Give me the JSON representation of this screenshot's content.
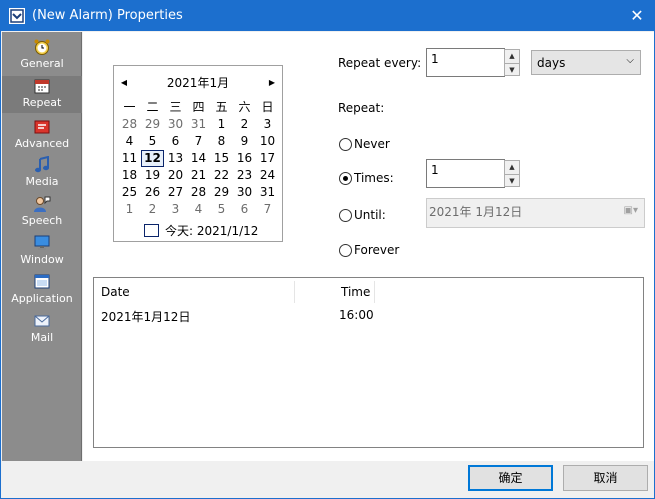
{
  "window": {
    "title": "(New Alarm) Properties",
    "close_glyph": "✕"
  },
  "sidebar": {
    "items": [
      {
        "label": "General",
        "icon": "clock-icon"
      },
      {
        "label": "Repeat",
        "icon": "calendar-icon",
        "active": true
      },
      {
        "label": "Advanced",
        "icon": "advanced-icon"
      },
      {
        "label": "Media",
        "icon": "music-note-icon"
      },
      {
        "label": "Speech",
        "icon": "speech-icon"
      },
      {
        "label": "Window",
        "icon": "monitor-icon"
      },
      {
        "label": "Application",
        "icon": "application-icon"
      },
      {
        "label": "Mail",
        "icon": "envelope-icon"
      }
    ]
  },
  "calendar": {
    "month_title": "2021年1月",
    "weekdays": [
      "一",
      "二",
      "三",
      "四",
      "五",
      "六",
      "日"
    ],
    "weeks": [
      [
        "28",
        "29",
        "30",
        "31",
        "1",
        "2",
        "3"
      ],
      [
        "4",
        "5",
        "6",
        "7",
        "8",
        "9",
        "10"
      ],
      [
        "11",
        "12",
        "13",
        "14",
        "15",
        "16",
        "17"
      ],
      [
        "18",
        "19",
        "20",
        "21",
        "22",
        "23",
        "24"
      ],
      [
        "25",
        "26",
        "27",
        "28",
        "29",
        "30",
        "31"
      ],
      [
        "1",
        "2",
        "3",
        "4",
        "5",
        "6",
        "7"
      ]
    ],
    "today_label": "今天: 2021/1/12"
  },
  "repeat": {
    "every_label": "Repeat every:",
    "every_value": "1",
    "unit_value": "days",
    "repeat_label": "Repeat:",
    "options": {
      "never": "Never",
      "times": "Times:",
      "until": "Until:",
      "forever": "Forever"
    },
    "times_value": "1",
    "until_value": "2021年  1月12日"
  },
  "list": {
    "columns": [
      "Date",
      "Time"
    ],
    "rows": [
      {
        "date": "2021年1月12日",
        "time": "16:00"
      }
    ]
  },
  "buttons": {
    "ok": "确定",
    "cancel": "取消"
  }
}
